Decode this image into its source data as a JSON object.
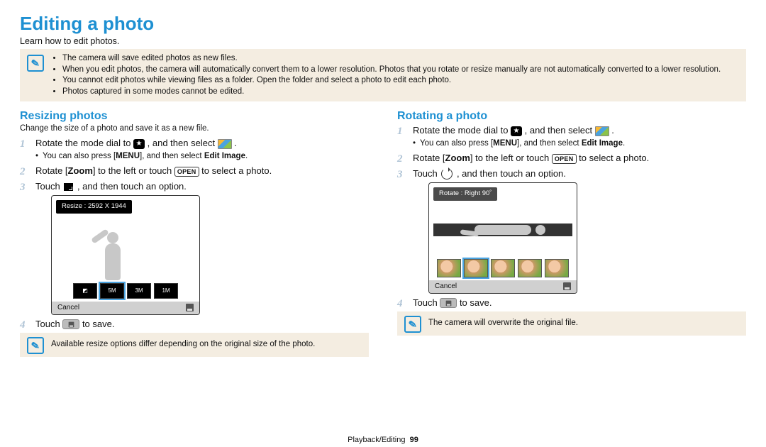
{
  "title": "Editing a photo",
  "intro": "Learn how to edit photos.",
  "top_notes": [
    "The camera will save edited photos as new files.",
    "When you edit photos, the camera will automatically convert them to a lower resolution. Photos that you rotate or resize manually are not automatically converted to a lower resolution.",
    "You cannot edit photos while viewing files as a folder. Open the folder and select a photo to edit each photo.",
    "Photos captured in some modes cannot be edited."
  ],
  "left": {
    "heading": "Resizing photos",
    "desc": "Change the size of a photo and save it as a new file.",
    "step1_a": "Rotate the mode dial to ",
    "step1_b": ", and then select ",
    "step1_c": ".",
    "sub1_a": "You can also press [",
    "sub1_menu": "MENU",
    "sub1_b": "], and then select ",
    "sub1_bold": "Edit Image",
    "sub1_c": ".",
    "step2_a": "Rotate [",
    "step2_zoom": "Zoom",
    "step2_b": "] to the left or touch ",
    "step2_open": "OPEN",
    "step2_c": " to select a photo.",
    "step3_a": "Touch ",
    "step3_b": ", and then touch an option.",
    "screen_label": "Resize : 2592 X 1944",
    "screen_cancel": "Cancel",
    "opts": [
      "◻",
      "5M",
      "3M",
      "1M"
    ],
    "step4_a": "Touch ",
    "step4_b": " to save.",
    "bottom_note": "Available resize options differ depending on the original size of the photo."
  },
  "right": {
    "heading": "Rotating a photo",
    "step1_a": "Rotate the mode dial to ",
    "step1_b": ", and then select ",
    "step1_c": ".",
    "sub1_a": "You can also press [",
    "sub1_menu": "MENU",
    "sub1_b": "], and then select ",
    "sub1_bold": "Edit Image",
    "sub1_c": ".",
    "step2_a": "Rotate [",
    "step2_zoom": "Zoom",
    "step2_b": "] to the left or touch ",
    "step2_open": "OPEN",
    "step2_c": " to select a photo.",
    "step3_a": "Touch ",
    "step3_b": ", and then touch an option.",
    "screen_label": "Rotate : Right 90˚",
    "screen_cancel": "Cancel",
    "step4_a": "Touch ",
    "step4_b": " to save.",
    "bottom_note": "The camera will overwrite the original file."
  },
  "footer": {
    "section": "Playback/Editing",
    "page": "99"
  }
}
